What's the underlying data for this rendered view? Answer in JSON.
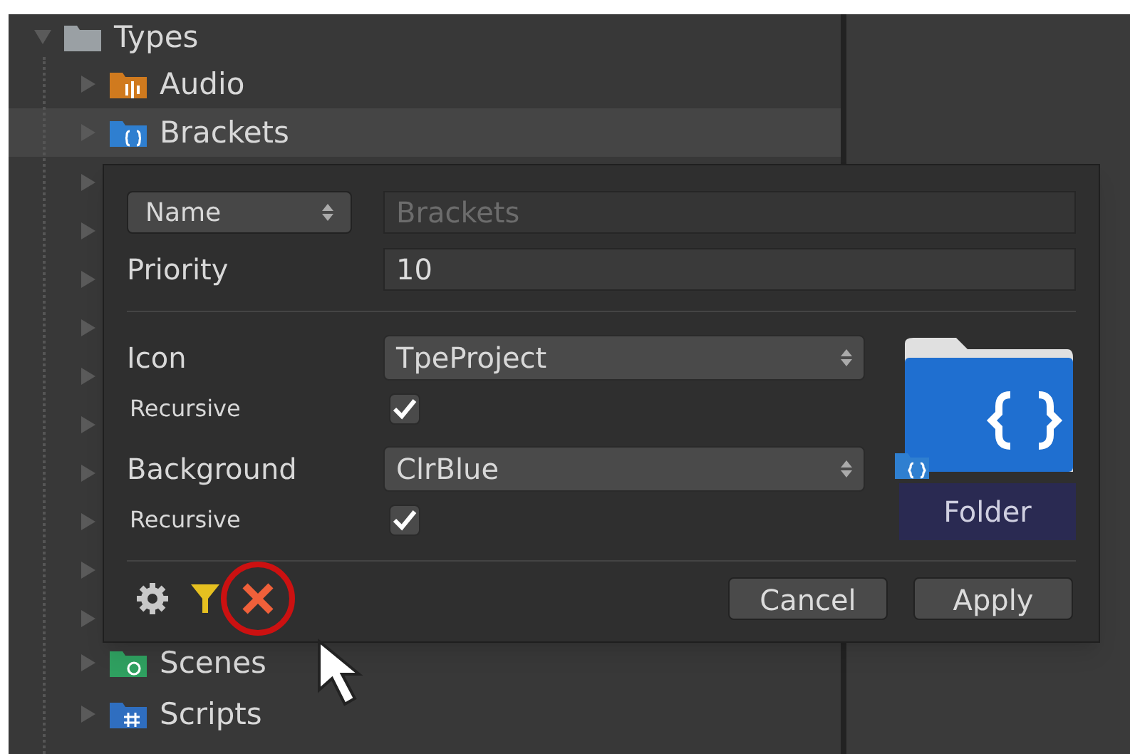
{
  "tree": {
    "label": "Types",
    "expanded": true,
    "children": [
      {
        "label": "Audio",
        "kind": "audio",
        "selected": false
      },
      {
        "label": "Brackets",
        "kind": "brackets",
        "selected": true
      }
    ],
    "after": [
      {
        "label": "Scenes",
        "kind": "scenes",
        "selected": false
      },
      {
        "label": "Scripts",
        "kind": "scripts",
        "selected": false
      }
    ]
  },
  "popup": {
    "filter_select": "Name",
    "name_field": {
      "placeholder": "Brackets"
    },
    "priority": {
      "label": "Priority",
      "value": "10"
    },
    "icon": {
      "label": "Icon",
      "value": "TpeProject",
      "recursive_label": "Recursive",
      "recursive": true
    },
    "background": {
      "label": "Background",
      "value": "ClrBlue",
      "recursive_label": "Recursive",
      "recursive": true
    },
    "preview": {
      "caption": "Folder"
    },
    "buttons": [
      "Cancel",
      "Apply"
    ]
  }
}
